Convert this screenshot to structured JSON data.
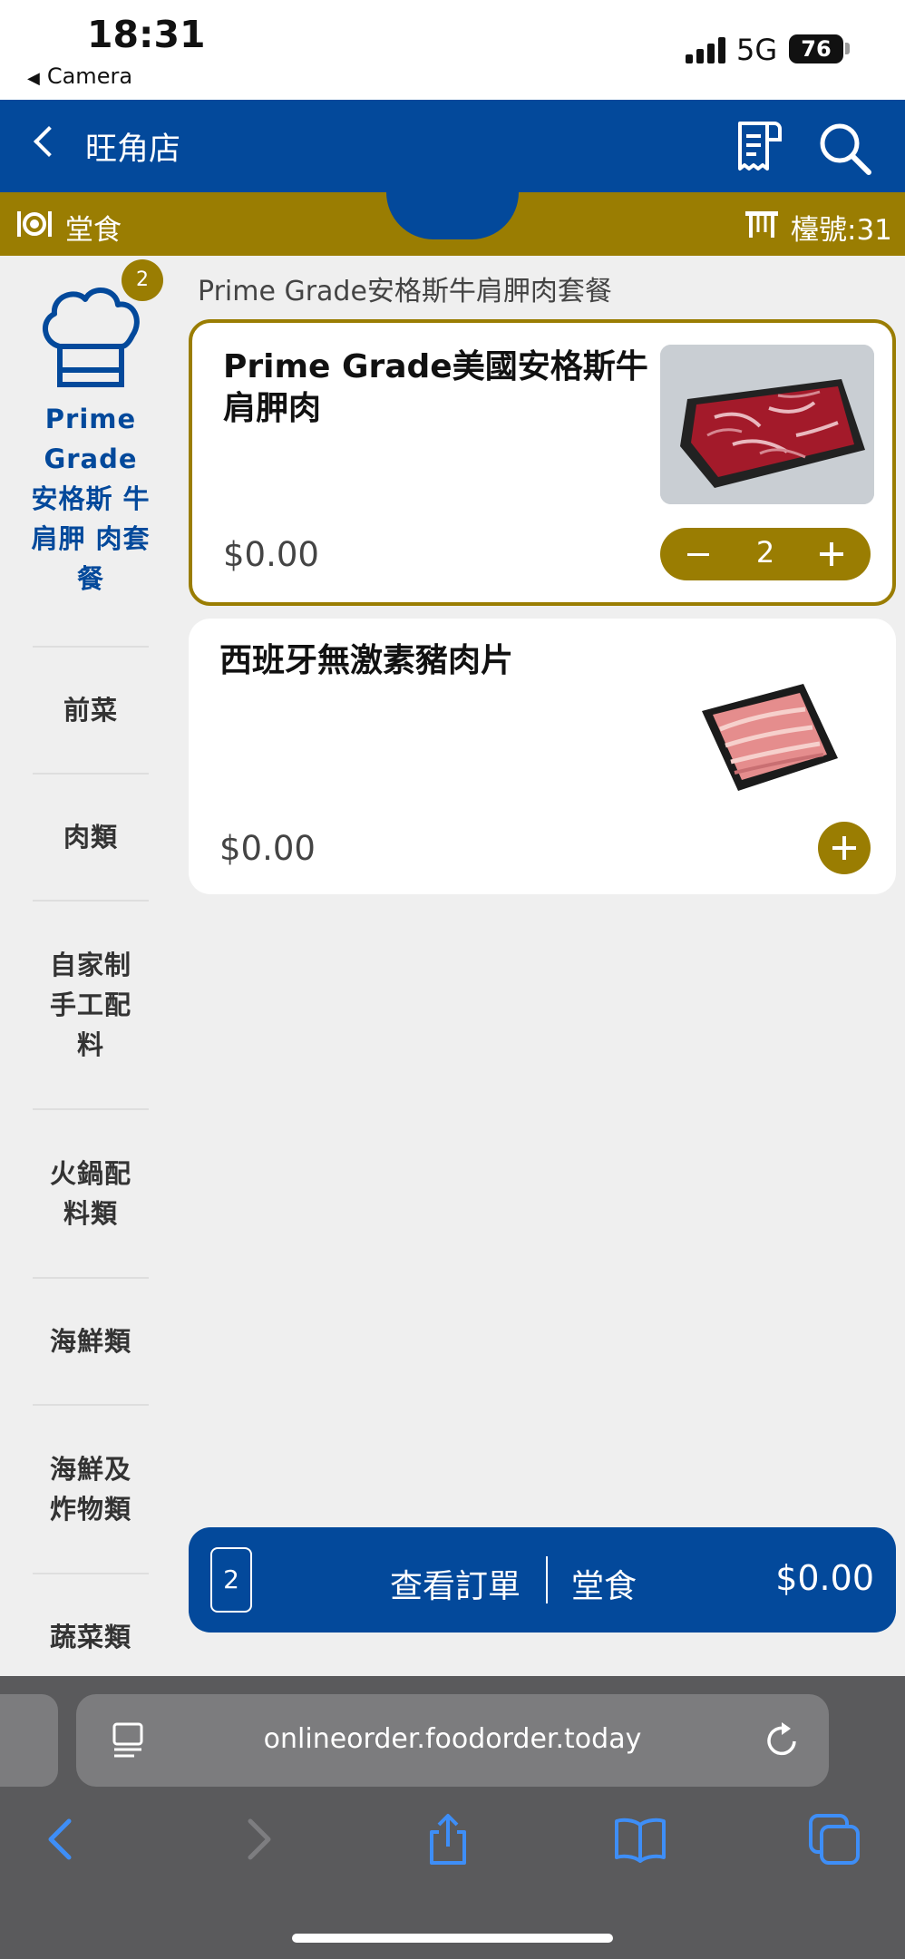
{
  "status_bar": {
    "time": "18:31",
    "back_app": "Camera",
    "network": "5G",
    "battery": "76"
  },
  "header": {
    "title": "旺角店",
    "back_icon": "chevron-left-icon",
    "receipt_icon": "receipt-icon",
    "search_icon": "search-icon"
  },
  "service_bar": {
    "mode": "堂食",
    "table": "檯號:31"
  },
  "sidebar": {
    "active": {
      "label": "Prime Grade 安格斯 牛肩胛 肉套餐",
      "badge": "2",
      "icon": "chef-hat-icon"
    },
    "items": [
      {
        "label": "前菜"
      },
      {
        "label": "肉類"
      },
      {
        "label": "自家制手工配料"
      },
      {
        "label": "火鍋配料類"
      },
      {
        "label": "海鮮類"
      },
      {
        "label": "海鮮及炸物類"
      },
      {
        "label": "蔬菜類"
      }
    ]
  },
  "main": {
    "category_title": "Prime Grade安格斯牛肩胛肉套餐",
    "products": [
      {
        "name": "Prime Grade美國安格斯牛肩胛肉",
        "price": "$0.00",
        "quantity": "2",
        "image": "beef-slices"
      },
      {
        "name": "西班牙無激素豬肉片",
        "price": "$0.00",
        "image": "pork-slices"
      }
    ]
  },
  "order_bar": {
    "count": "2",
    "label": "查看訂單",
    "mode": "堂食",
    "total": "$0.00"
  },
  "browser": {
    "url": "onlineorder.foodorder.today"
  },
  "colors": {
    "primary_blue": "#03499b",
    "gold": "#9a7d02",
    "background": "#efefef"
  }
}
